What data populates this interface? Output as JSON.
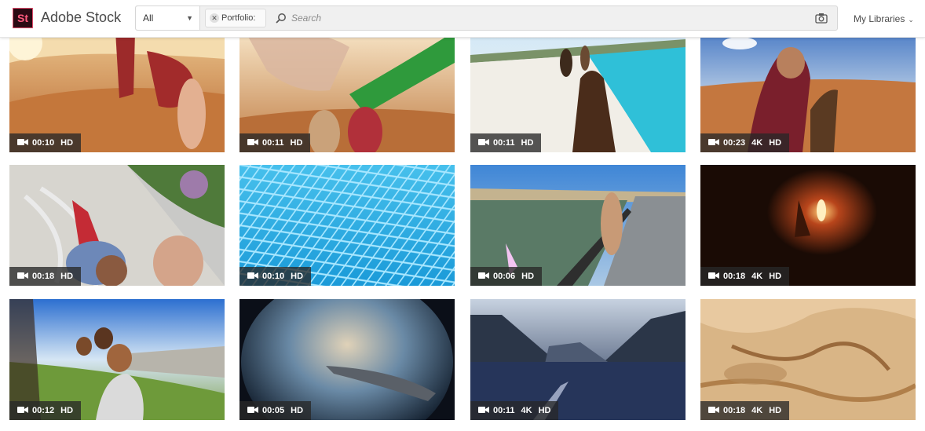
{
  "header": {
    "logo_text": "St",
    "brand": "Adobe Stock",
    "filter_value": "All",
    "chip_label": "Portfolio:",
    "search_placeholder": "Search",
    "libraries_label": "My Libraries"
  },
  "videos": [
    {
      "duration": "00:10",
      "quality": [
        "HD"
      ],
      "scene": "desert-feet"
    },
    {
      "duration": "00:11",
      "quality": [
        "HD"
      ],
      "scene": "desert-scarves"
    },
    {
      "duration": "00:11",
      "quality": [
        "HD"
      ],
      "scene": "beach-horse"
    },
    {
      "duration": "00:23",
      "quality": [
        "4K",
        "HD"
      ],
      "scene": "desert-camel"
    },
    {
      "duration": "00:18",
      "quality": [
        "HD"
      ],
      "scene": "spinning-child"
    },
    {
      "duration": "00:10",
      "quality": [
        "HD"
      ],
      "scene": "pool-tiles"
    },
    {
      "duration": "00:06",
      "quality": [
        "HD"
      ],
      "scene": "river-bridge"
    },
    {
      "duration": "00:18",
      "quality": [
        "4K",
        "HD"
      ],
      "scene": "cave-fire"
    },
    {
      "duration": "00:12",
      "quality": [
        "HD"
      ],
      "scene": "family-selfie"
    },
    {
      "duration": "00:05",
      "quality": [
        "HD"
      ],
      "scene": "airplane-window"
    },
    {
      "duration": "00:11",
      "quality": [
        "4K",
        "HD"
      ],
      "scene": "fjord-boat"
    },
    {
      "duration": "00:18",
      "quality": [
        "4K",
        "HD"
      ],
      "scene": "sand-dunes"
    }
  ]
}
